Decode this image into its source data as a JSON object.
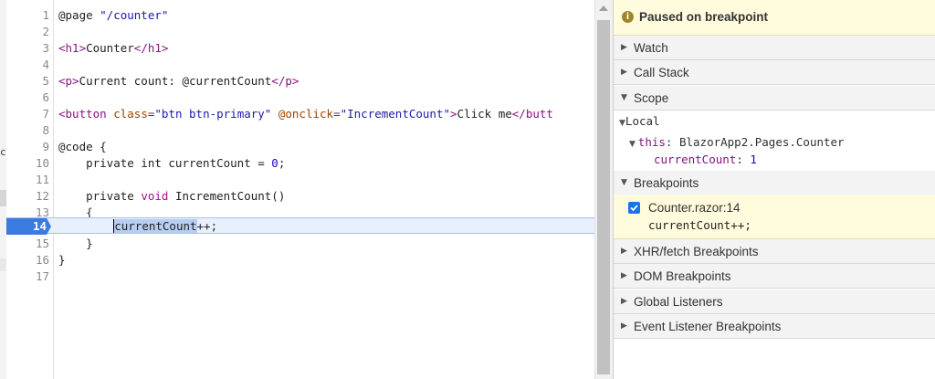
{
  "editor": {
    "lines": [
      {
        "n": "1"
      },
      {
        "n": "2"
      },
      {
        "n": "3"
      },
      {
        "n": "4"
      },
      {
        "n": "5"
      },
      {
        "n": "6"
      },
      {
        "n": "7"
      },
      {
        "n": "8"
      },
      {
        "n": "9"
      },
      {
        "n": "10"
      },
      {
        "n": "11"
      },
      {
        "n": "12"
      },
      {
        "n": "13"
      },
      {
        "n": "14"
      },
      {
        "n": "15"
      },
      {
        "n": "16"
      },
      {
        "n": "17"
      }
    ],
    "tokens": {
      "l1_a": "@page ",
      "l1_b": "\"/counter\"",
      "l3_a": "<h1>",
      "l3_b": "Counter",
      "l3_c": "</h1>",
      "l5_a": "<p>",
      "l5_b": "Current count: @currentCount",
      "l5_c": "</p>",
      "l7_a": "<button ",
      "l7_b": "class",
      "l7_c": "=",
      "l7_d": "\"btn btn-primary\"",
      "l7_e": " @onclick",
      "l7_f": "=",
      "l7_g": "\"IncrementCount\"",
      "l7_h": ">",
      "l7_i": "Click me",
      "l7_j": "</butt",
      "l9": "@code {",
      "l10_a": "    private int currentCount = ",
      "l10_b": "0",
      "l10_c": ";",
      "l12_a": "    private ",
      "l12_b": "void",
      "l12_c": " IncrementCount()",
      "l13": "    {",
      "l14_pre": "        ",
      "l14_sel": "currentCount",
      "l14_post": "++;",
      "l15": "    }",
      "l16": "}"
    },
    "active_line": "14"
  },
  "side_strip": {
    "char": "c"
  },
  "debugger": {
    "status": "Paused on breakpoint",
    "info_icon": "i",
    "sections": {
      "watch": "Watch",
      "call_stack": "Call Stack",
      "scope": "Scope",
      "breakpoints": "Breakpoints",
      "xhr": "XHR/fetch Breakpoints",
      "dom": "DOM Breakpoints",
      "global": "Global Listeners",
      "event": "Event Listener Breakpoints"
    },
    "scope": {
      "local_label": "Local",
      "this_name": "this",
      "this_sep": ": ",
      "this_value": "BlazorApp2.Pages.Counter",
      "var_name": "currentCount",
      "var_sep": ": ",
      "var_value": "1"
    },
    "breakpoint": {
      "location": "Counter.razor:14",
      "code": "currentCount++;",
      "checked": true
    }
  },
  "colors": {
    "accent": "#3b7be0",
    "paused_bg": "#fffbdc"
  }
}
